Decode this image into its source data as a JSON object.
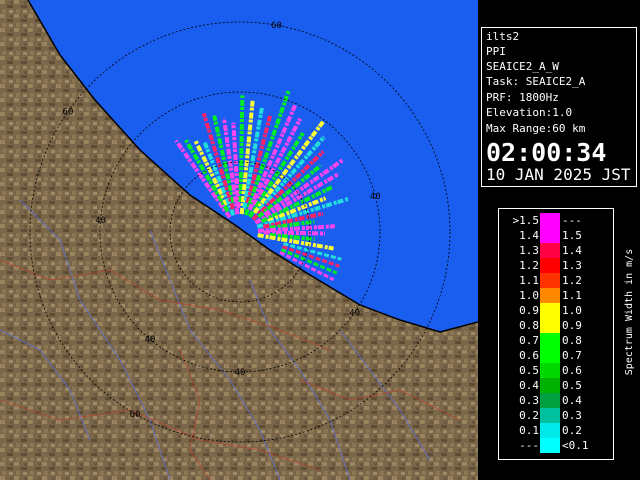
{
  "info": {
    "station": "ilts2",
    "scan_mode": "PPI",
    "product": "SEAICE2_A_W",
    "task": "Task: SEAICE2_A",
    "prf": "PRF: 1800Hz",
    "elevation": "Elevation:1.0",
    "max_range": "Max Range:60 km",
    "time": "02:00:34",
    "date": "10 JAN 2025 JST"
  },
  "legend": {
    "unit_label": "Spectrum Width in m/s",
    "left_labels": [
      ">1.5",
      "1.4",
      "1.3",
      "1.2",
      "1.1",
      "1.0",
      "0.9",
      "0.8",
      "0.7",
      "0.6",
      "0.5",
      "0.4",
      "0.3",
      "0.2",
      "0.1",
      "---"
    ],
    "right_labels": [
      "---",
      "1.5",
      "1.4",
      "1.3",
      "1.2",
      "1.1",
      "1.0",
      "0.9",
      "0.8",
      "0.7",
      "0.6",
      "0.5",
      "0.4",
      "0.3",
      "0.2",
      "<0.1"
    ],
    "colors": [
      "#ff00ff",
      "#ff00ff",
      "#ff0044",
      "#ff0000",
      "#ff3300",
      "#ff8800",
      "#ffff00",
      "#ffff00",
      "#00ff00",
      "#00ff00",
      "#00d800",
      "#00b000",
      "#00a040",
      "#00c0a0",
      "#00e8e8",
      "#00ffff"
    ]
  },
  "map": {
    "colors": {
      "sea": "#1a5ef0",
      "land": "#7a6648",
      "echo_magenta": "#ff44ee",
      "echo_green": "#00ee22",
      "echo_yellow": "#ffff33",
      "echo_cyan": "#22dddd"
    },
    "range_ring_km": [
      20,
      40,
      60
    ],
    "range_labels": [
      {
        "text": "60",
        "ring": 60,
        "bearing_deg": 305
      },
      {
        "text": "60",
        "ring": 60,
        "bearing_deg": 10
      },
      {
        "text": "40",
        "ring": 40,
        "bearing_deg": 75
      },
      {
        "text": "40",
        "ring": 40,
        "bearing_deg": 275
      },
      {
        "text": "40",
        "ring": 40,
        "bearing_deg": 125
      },
      {
        "text": "40",
        "ring": 40,
        "bearing_deg": 220
      },
      {
        "text": "40",
        "ring": 40,
        "bearing_deg": 180
      },
      {
        "text": "60",
        "ring": 60,
        "bearing_deg": 210
      }
    ]
  }
}
